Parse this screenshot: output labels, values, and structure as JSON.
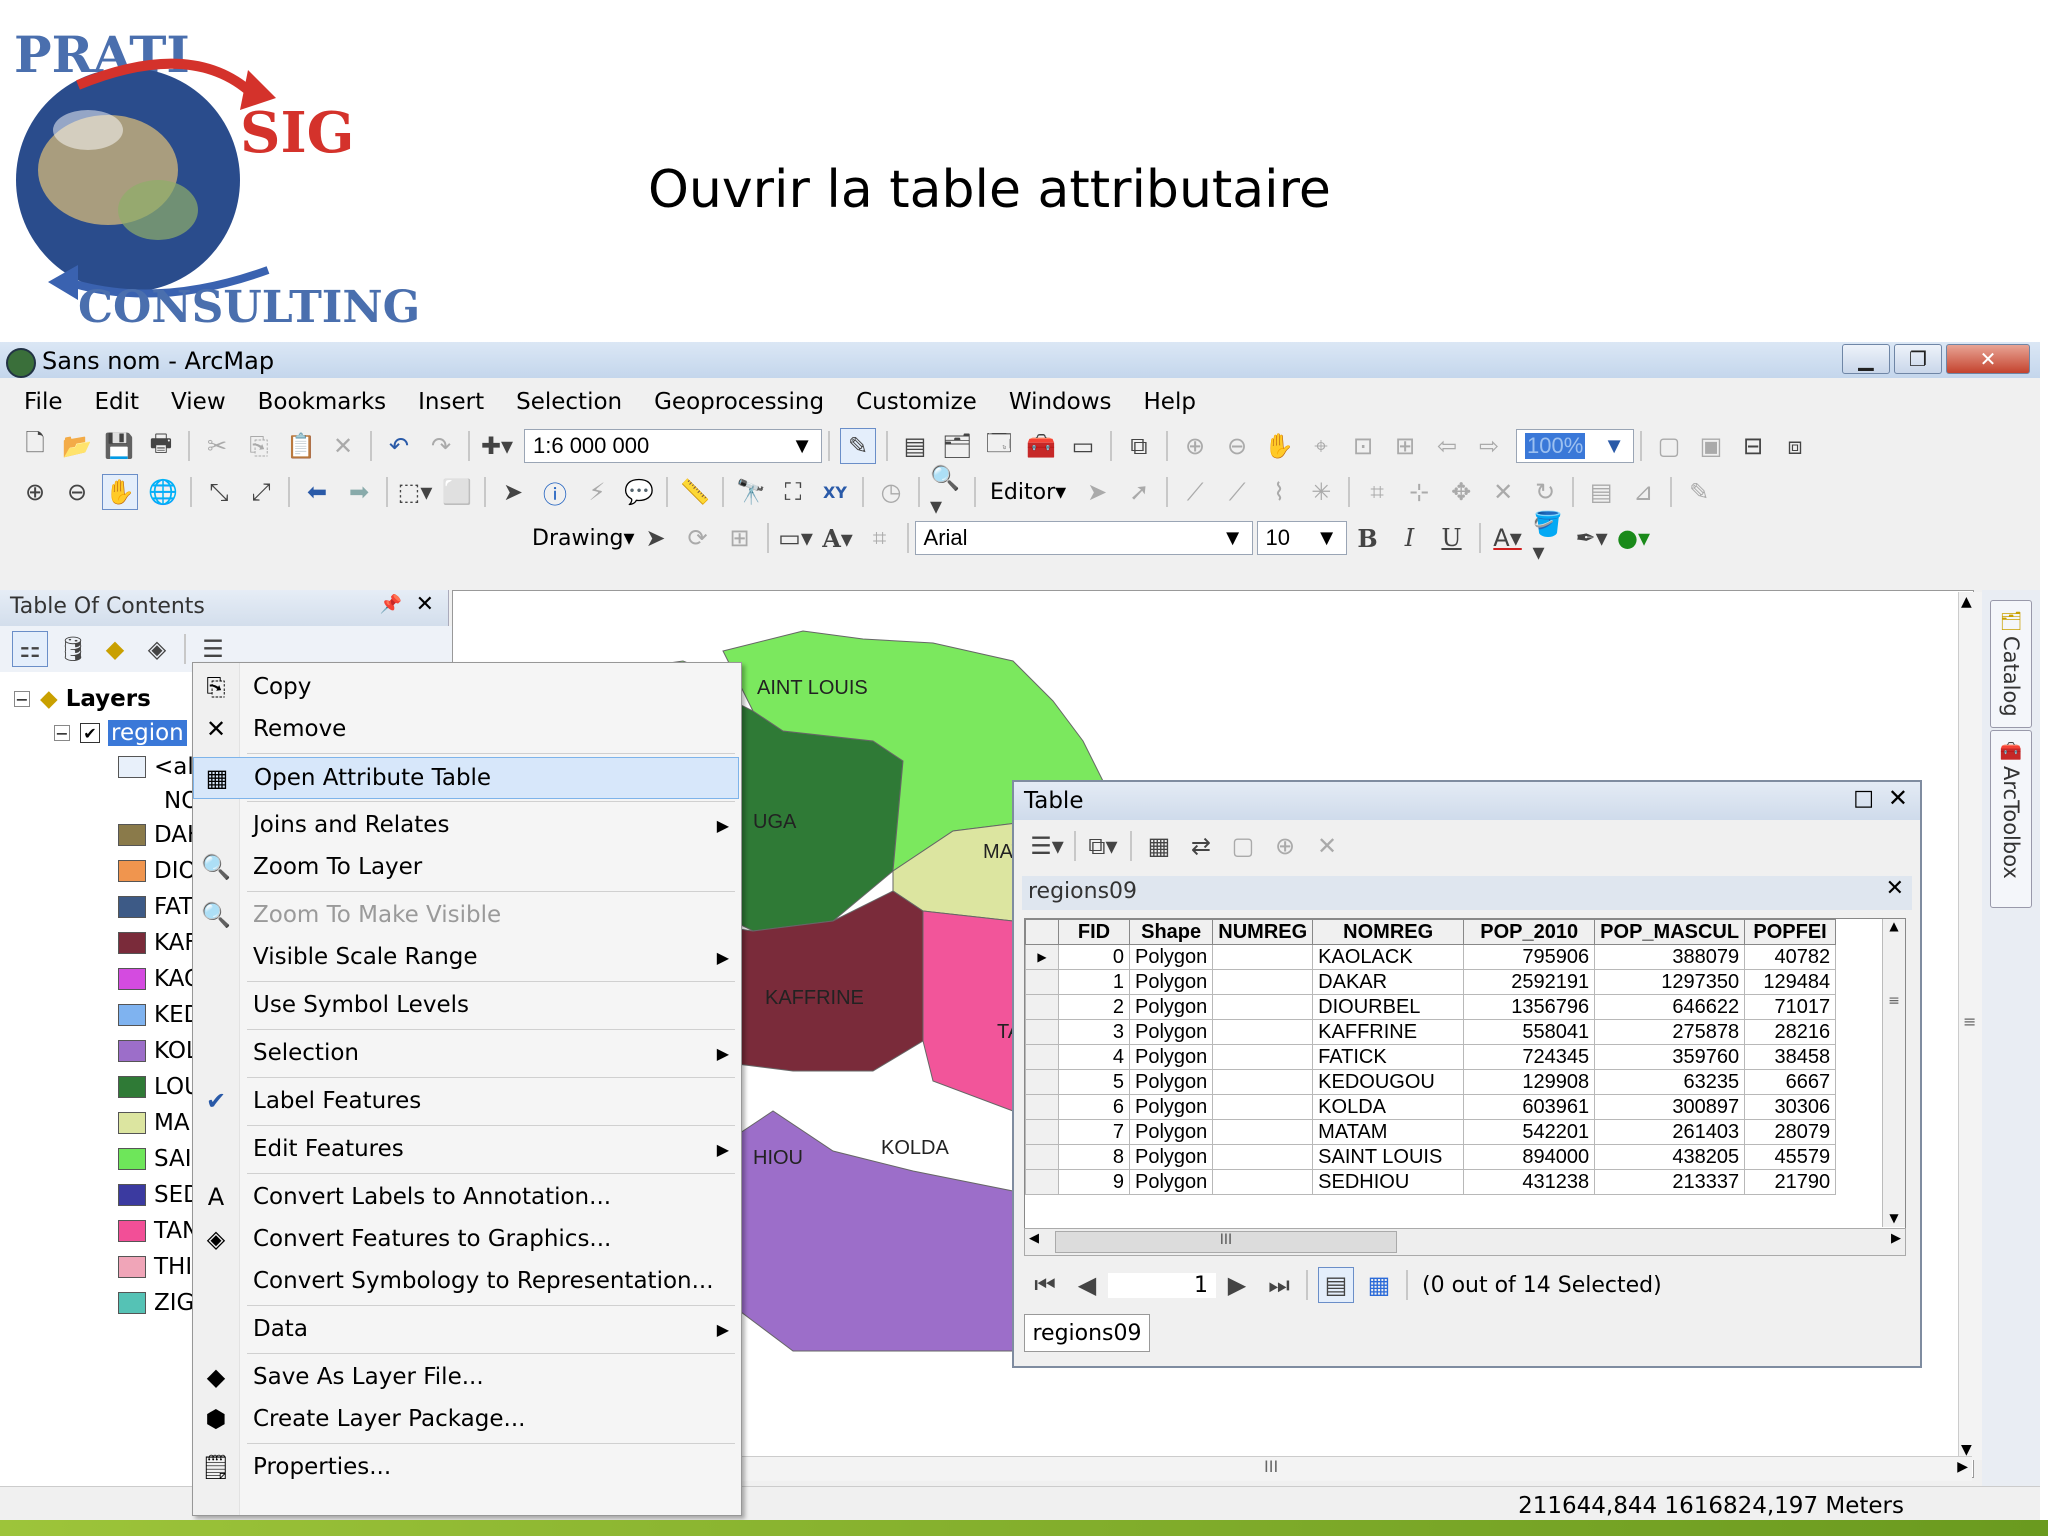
{
  "slide": {
    "title": "Ouvrir la table attributaire",
    "logo_text": [
      "PRATI",
      "SIG",
      "CONSULTING"
    ]
  },
  "window": {
    "title": "Sans nom - ArcMap"
  },
  "menubar": [
    "File",
    "Edit",
    "View",
    "Bookmarks",
    "Insert",
    "Selection",
    "Geoprocessing",
    "Customize",
    "Windows",
    "Help"
  ],
  "toolbar": {
    "scale": "1:6 000 000",
    "zoom_percent": "100%",
    "editor_label": "Editor",
    "drawing_label": "Drawing",
    "font_name": "Arial",
    "font_size": "10"
  },
  "toc": {
    "title": "Table Of Contents",
    "layers_label": "Layers",
    "layer_name": "region",
    "all_other": "<all",
    "field_label": "NO",
    "legend": [
      {
        "label": "DAK",
        "color": "#8a7a4a"
      },
      {
        "label": "DIO",
        "color": "#f0954e"
      },
      {
        "label": "FAT",
        "color": "#3d5a86"
      },
      {
        "label": "KAF",
        "color": "#7a2b3a"
      },
      {
        "label": "KAO",
        "color": "#d44be0"
      },
      {
        "label": "KED",
        "color": "#7fb3f0"
      },
      {
        "label": "KOL",
        "color": "#9c6ec9"
      },
      {
        "label": "LOU",
        "color": "#2f7a36"
      },
      {
        "label": "MA",
        "color": "#dce5a0"
      },
      {
        "label": "SAI",
        "color": "#6ee65a"
      },
      {
        "label": "SED",
        "color": "#3b3aa0"
      },
      {
        "label": "TAN",
        "color": "#f24f97"
      },
      {
        "label": "THI",
        "color": "#f0a5b8"
      },
      {
        "label": "ZIG",
        "color": "#55c2b5"
      }
    ]
  },
  "context_menu": {
    "items": [
      {
        "label": "Copy",
        "icon": "copy-icon"
      },
      {
        "label": "Remove",
        "icon": "remove-icon"
      },
      {
        "label": "Open Attribute Table",
        "icon": "table-icon",
        "highlighted": true
      },
      {
        "label": "Joins and Relates",
        "submenu": true
      },
      {
        "label": "Zoom To Layer",
        "icon": "zoom-layer-icon"
      },
      {
        "label": "Zoom To Make Visible",
        "icon": "zoom-visible-icon",
        "disabled": true
      },
      {
        "label": "Visible Scale Range",
        "submenu": true
      },
      {
        "label": "Use Symbol Levels"
      },
      {
        "label": "Selection",
        "submenu": true
      },
      {
        "label": "Label Features",
        "checked": true
      },
      {
        "label": "Edit Features",
        "submenu": true
      },
      {
        "label": "Convert Labels to Annotation...",
        "icon": "annotation-icon"
      },
      {
        "label": "Convert Features to Graphics...",
        "icon": "graphics-icon"
      },
      {
        "label": "Convert Symbology to Representation..."
      },
      {
        "label": "Data",
        "submenu": true
      },
      {
        "label": "Save As Layer File...",
        "icon": "layer-file-icon"
      },
      {
        "label": "Create Layer Package...",
        "icon": "layer-package-icon"
      },
      {
        "label": "Properties...",
        "icon": "properties-icon"
      }
    ]
  },
  "map": {
    "labels": [
      "AINT LOUIS",
      "UGA",
      "MATA",
      "KAFFRINE",
      "TAM",
      "KOLDA",
      "HIOU"
    ],
    "colors": {
      "saint_louis": "#7be85e",
      "louga": "#2f7a36",
      "matam": "#dce5a0",
      "kaffrine": "#7a2b3a",
      "tambacounda": "#f2559a",
      "kolda": "#9c6ec9",
      "sedhiou": "#4a3aa8",
      "dakar_region": "#f0954e"
    }
  },
  "status": {
    "coords": "211644,844  1616824,197 Meters"
  },
  "side_tabs": [
    "Catalog",
    "ArcToolbox"
  ],
  "table_window": {
    "title": "Table",
    "tab_name": "regions09",
    "columns": [
      "FID",
      "Shape",
      "NUMREG",
      "NOMREG",
      "POP_2010",
      "POP_MASCUL",
      "POPFEI"
    ],
    "rows": [
      [
        "0",
        "Polygon",
        "",
        "KAOLACK",
        "795906",
        "388079",
        "40782"
      ],
      [
        "1",
        "Polygon",
        "",
        "DAKAR",
        "2592191",
        "1297350",
        "129484"
      ],
      [
        "2",
        "Polygon",
        "",
        "DIOURBEL",
        "1356796",
        "646622",
        "71017"
      ],
      [
        "3",
        "Polygon",
        "",
        "KAFFRINE",
        "558041",
        "275878",
        "28216"
      ],
      [
        "4",
        "Polygon",
        "",
        "FATICK",
        "724345",
        "359760",
        "38458"
      ],
      [
        "5",
        "Polygon",
        "",
        "KEDOUGOU",
        "129908",
        "63235",
        "6667"
      ],
      [
        "6",
        "Polygon",
        "",
        "KOLDA",
        "603961",
        "300897",
        "30306"
      ],
      [
        "7",
        "Polygon",
        "",
        "MATAM",
        "542201",
        "261403",
        "28079"
      ],
      [
        "8",
        "Polygon",
        "",
        "SAINT LOUIS",
        "894000",
        "438205",
        "45579"
      ],
      [
        "9",
        "Polygon",
        "",
        "SEDHIOU",
        "431238",
        "213337",
        "21790"
      ]
    ],
    "record_number": "1",
    "selection_status": "(0 out of 14 Selected)"
  }
}
